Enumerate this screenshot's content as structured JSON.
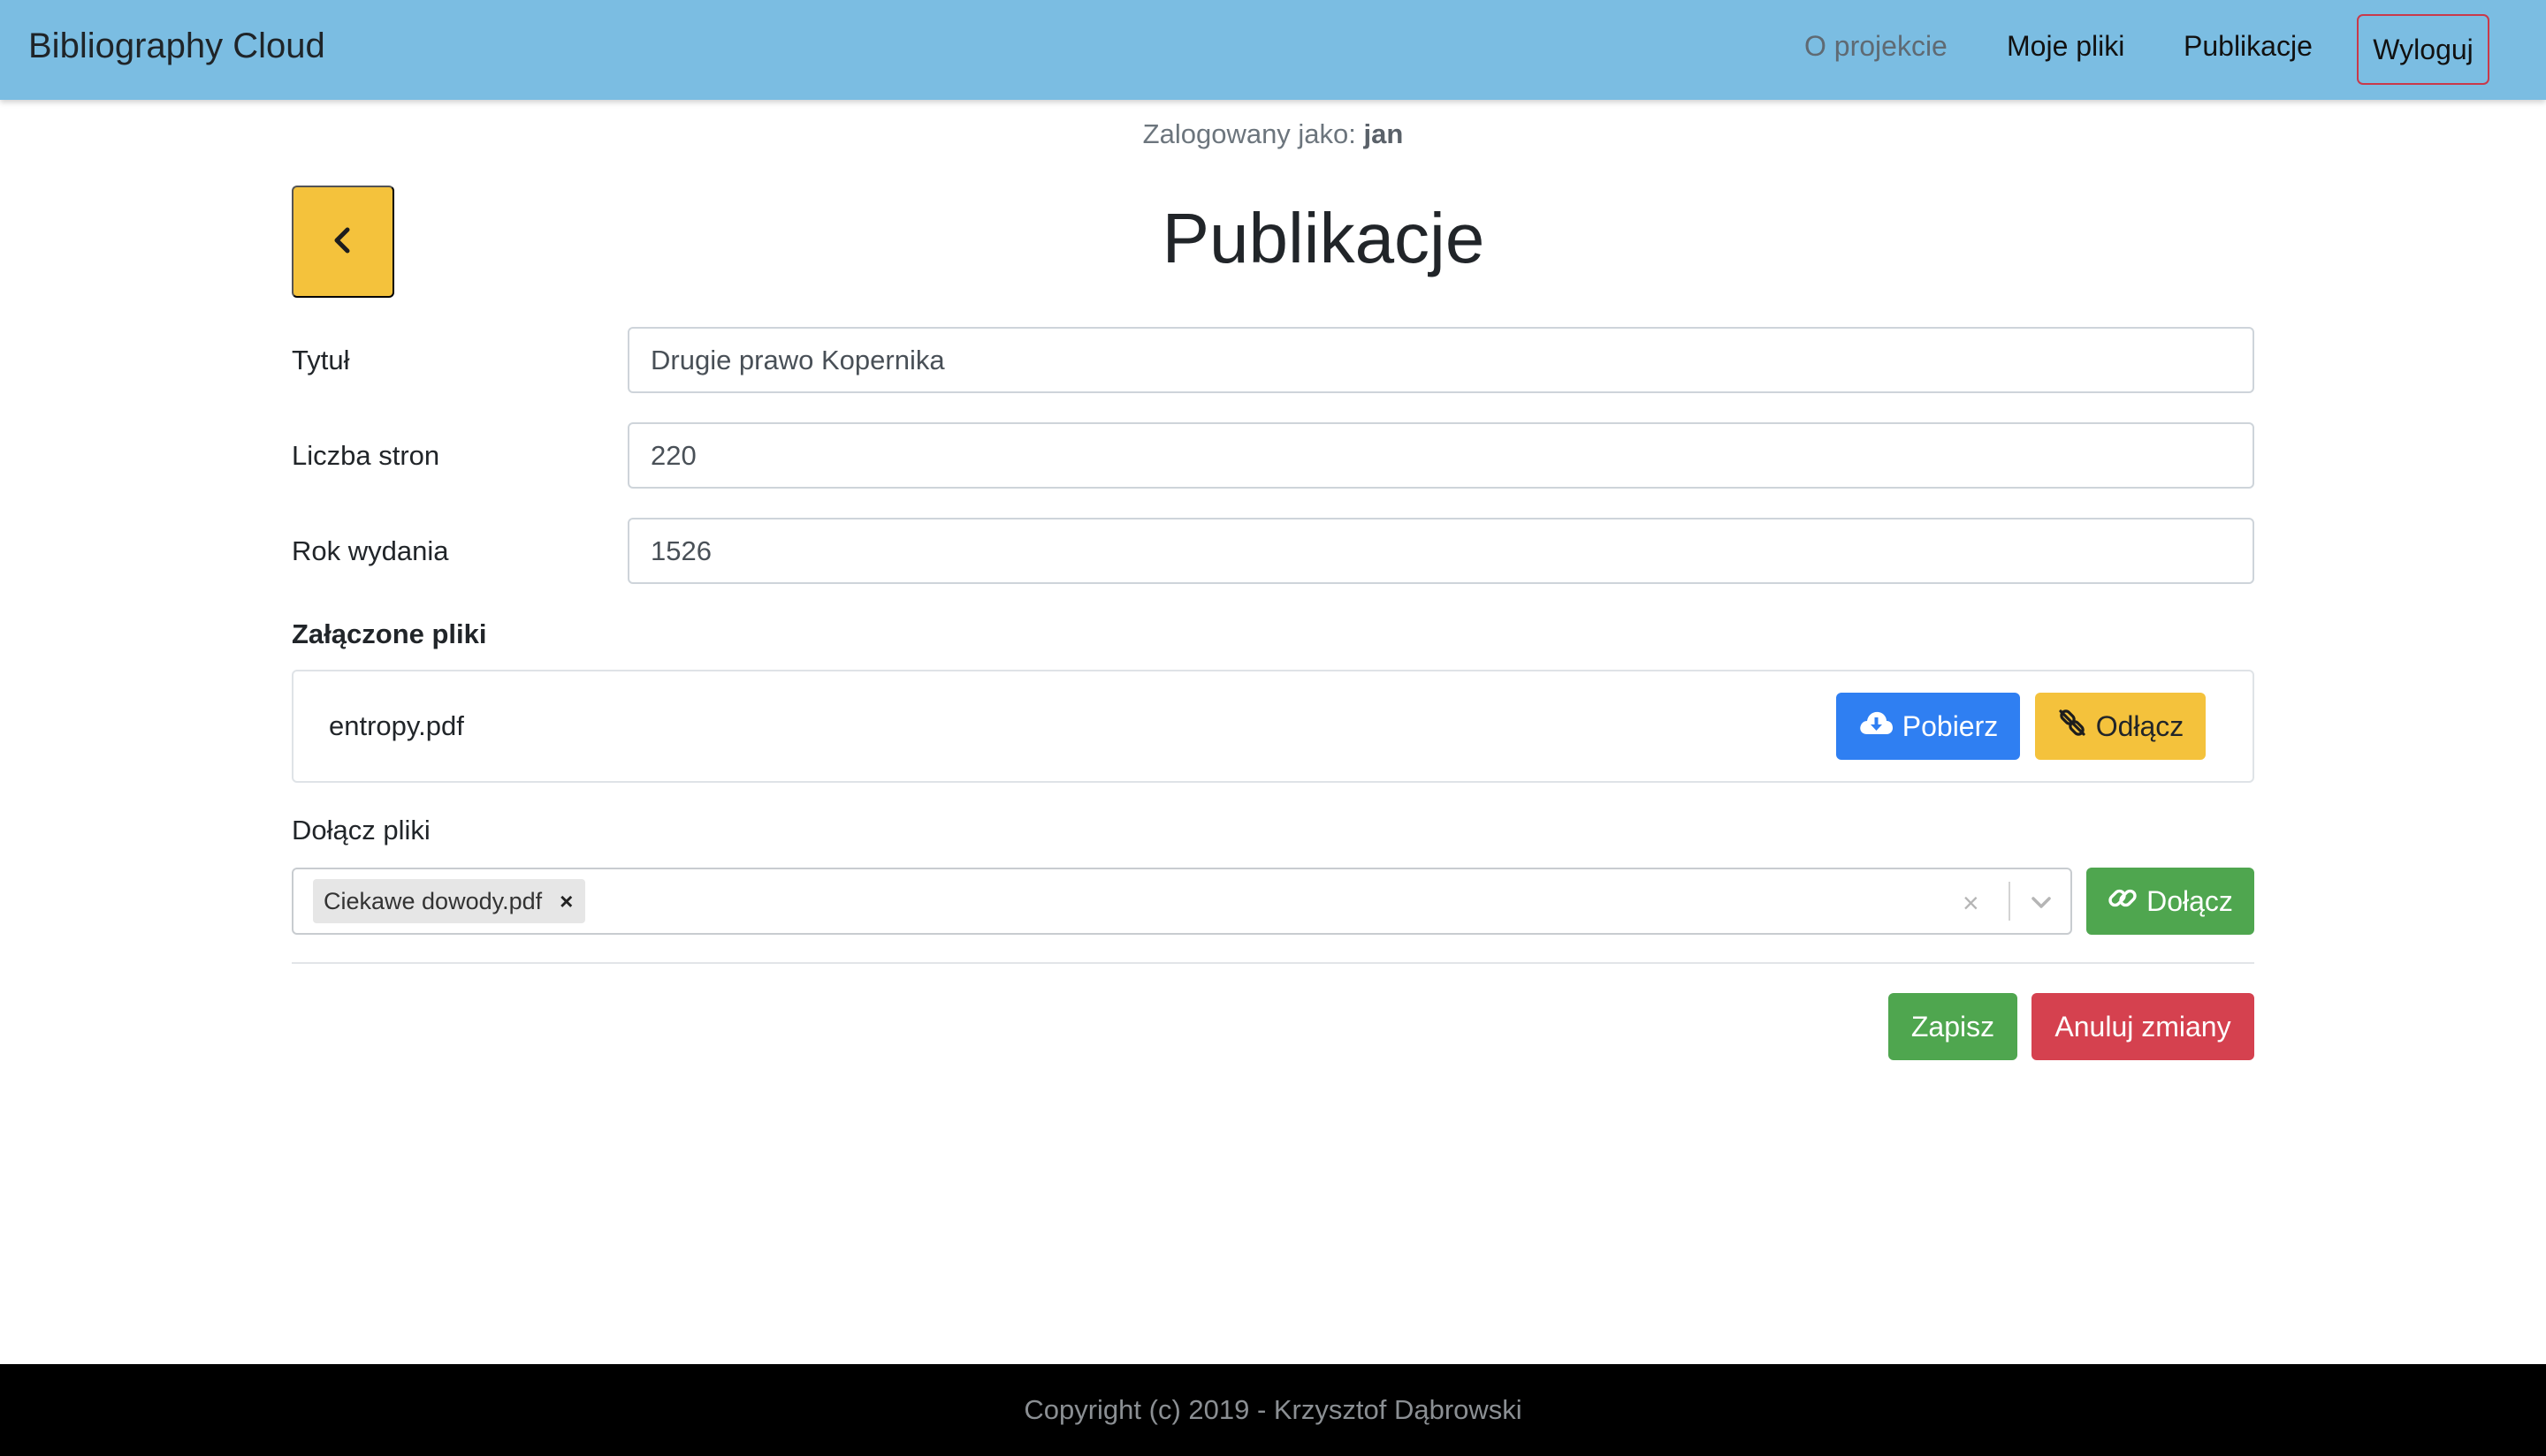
{
  "navbar": {
    "brand": "Bibliography Cloud",
    "links": [
      "O projekcie",
      "Moje pliki",
      "Publikacje"
    ],
    "logout": "Wyloguj"
  },
  "session": {
    "prefix": "Zalogowany jako: ",
    "user": "jan"
  },
  "page": {
    "title": "Publikacje",
    "back_icon": "chevron-left-icon"
  },
  "form": {
    "title_label": "Tytuł",
    "title_value": "Drugie prawo Kopernika",
    "pages_label": "Liczba stron",
    "pages_value": "220",
    "year_label": "Rok wydania",
    "year_value": "1526"
  },
  "attached": {
    "heading": "Załączone pliki",
    "files": [
      {
        "name": "entropy.pdf",
        "download_label": "Pobierz",
        "detach_label": "Odłącz"
      }
    ]
  },
  "attach": {
    "label": "Dołącz pliki",
    "selected": [
      "Ciekawe dowody.pdf"
    ],
    "chip_remove": "×",
    "clear_symbol": "×",
    "button_label": "Dołącz"
  },
  "actions": {
    "save": "Zapisz",
    "cancel": "Anuluj zmiany"
  },
  "footer": {
    "text": "Copyright (c) 2019 - Krzysztof Dąbrowski"
  },
  "colors": {
    "navbar": "#7bbde2",
    "warning": "#f4c23c",
    "primary": "#2f7ff2",
    "success": "#4fa64f",
    "danger": "#d5414f",
    "footer": "#000000"
  }
}
